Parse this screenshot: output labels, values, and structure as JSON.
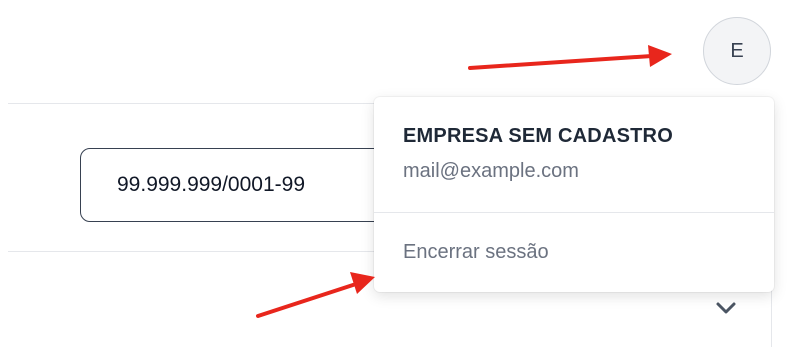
{
  "header": {
    "avatar_initial": "E"
  },
  "main": {
    "cnpj_value": "99.999.999/0001-99"
  },
  "user_menu": {
    "company_name": "EMPRESA SEM CADASTRO",
    "email": "mail@example.com",
    "logout_label": "Encerrar sessão"
  },
  "annotation_color": "#e8261c"
}
